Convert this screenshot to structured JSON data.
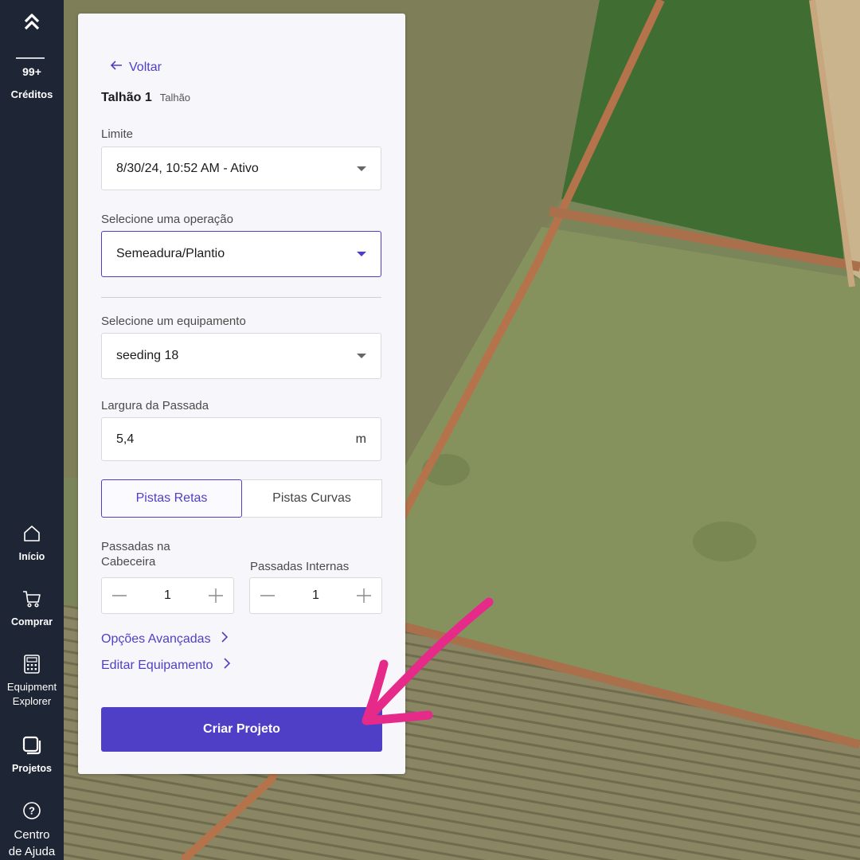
{
  "sidebar": {
    "credits_count": "99+",
    "credits_label": "Créditos",
    "items": [
      {
        "label": "Início",
        "icon": "home-icon"
      },
      {
        "label": "Comprar",
        "icon": "cart-icon"
      },
      {
        "label": "Equipment\nExplorer",
        "icon": "calculator-icon"
      },
      {
        "label": "Projetos",
        "icon": "projects-icon"
      },
      {
        "label": "Centro\nde Ajuda",
        "icon": "help-icon"
      }
    ]
  },
  "panel": {
    "back_label": "Voltar",
    "title": "Talhão 1",
    "subtitle": "Talhão",
    "limit": {
      "label": "Limite",
      "value": "8/30/24, 10:52 AM - Ativo"
    },
    "operation": {
      "label": "Selecione uma operação",
      "value": "Semeadura/Plantio"
    },
    "equipment": {
      "label": "Selecione um equipamento",
      "value": "seeding 18"
    },
    "width": {
      "label": "Largura da Passada",
      "value": "5,4",
      "unit": "m"
    },
    "track_mode": {
      "options": [
        "Pistas Retas",
        "Pistas Curvas"
      ],
      "selected": "Pistas Retas"
    },
    "headland_passes": {
      "label": "Passadas na\nCabeceira",
      "value": "1"
    },
    "inner_passes": {
      "label": "Passadas Internas",
      "value": "1"
    },
    "advanced_link": "Opções Avançadas",
    "edit_equipment_link": "Editar Equipamento",
    "create_button": "Criar Projeto"
  },
  "colors": {
    "accent": "#4f3fc7",
    "rail": "#1e2635",
    "annotation_arrow": "#e52a8a"
  }
}
